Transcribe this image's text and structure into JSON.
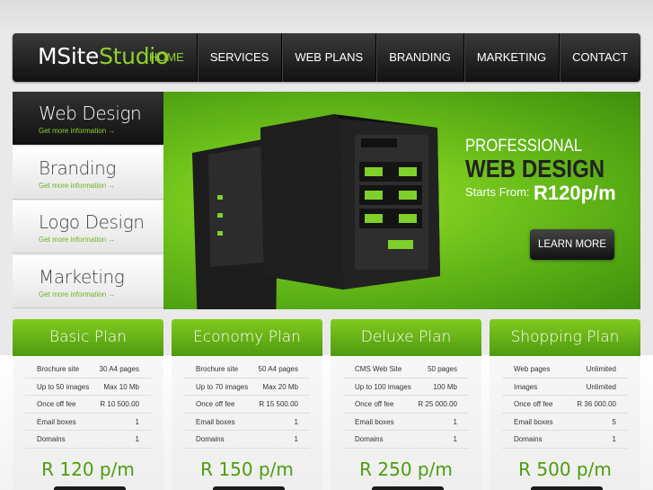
{
  "brand": {
    "logo_part1": "MSite",
    "logo_part2": "Studio"
  },
  "nav": [
    "HOME",
    "SERVICES",
    "WEB PLANS",
    "BRANDING",
    "MARKETING",
    "CONTACT"
  ],
  "sidebar": {
    "more_text": "Get more information  →",
    "items": [
      {
        "label": "Web Design"
      },
      {
        "label": "Branding"
      },
      {
        "label": "Logo Design"
      },
      {
        "label": "Marketing"
      }
    ]
  },
  "hero": {
    "headline": "PROFESSIONAL",
    "big": "WEB DESIGN",
    "starts": "Starts From:",
    "price": "R120p/m",
    "button": "LEARN MORE"
  },
  "plans": [
    {
      "name": "Basic Plan",
      "price": "R 120 p/m",
      "rows": [
        [
          "Brochure site",
          "30 A4 pages"
        ],
        [
          "Up to 50 images",
          "Max 10 Mb"
        ],
        [
          "Once off fee",
          "R 10 500.00"
        ],
        [
          "Email boxes",
          "1"
        ],
        [
          "Domains",
          "1"
        ]
      ]
    },
    {
      "name": "Economy Plan",
      "price": "R 150 p/m",
      "rows": [
        [
          "Brochure site",
          "50 A4 pages"
        ],
        [
          "Up to 70 images",
          "Max 20 Mb"
        ],
        [
          "Once off fee",
          "R 15 500.00"
        ],
        [
          "Email boxes",
          "1"
        ],
        [
          "Domains",
          "1"
        ]
      ]
    },
    {
      "name": "Deluxe Plan",
      "price": "R 250 p/m",
      "rows": [
        [
          "CMS Web Site",
          "50 pages"
        ],
        [
          "Up to 100 images",
          "100 Mb"
        ],
        [
          "Once off fee",
          "R 25 000.00"
        ],
        [
          "Email boxes",
          "1"
        ],
        [
          "Domains",
          "1"
        ]
      ]
    },
    {
      "name": "Shopping Plan",
      "price": "R 500 p/m",
      "rows": [
        [
          "Web pages",
          "Unlimited"
        ],
        [
          "Images",
          "Unlimited"
        ],
        [
          "Once off fee",
          "R 36 000.00"
        ],
        [
          "Email boxes",
          "5"
        ],
        [
          "Domains",
          "1"
        ]
      ]
    }
  ],
  "colors": {
    "accent": "#8ed12b",
    "dark": "#1b1b1b",
    "price": "#4c9e0c"
  }
}
